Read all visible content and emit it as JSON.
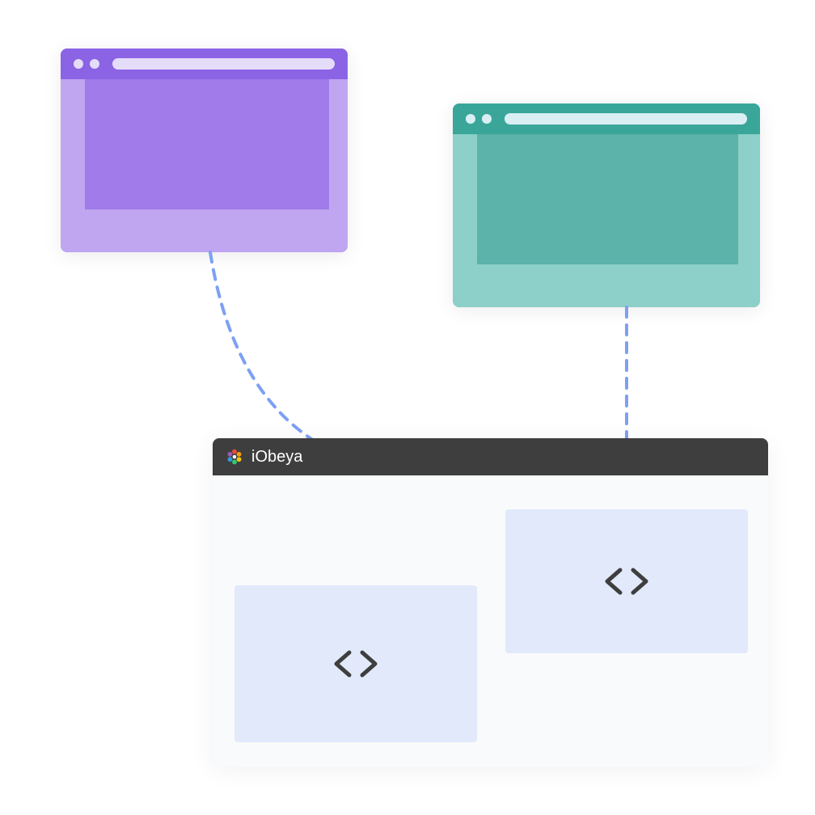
{
  "iobeya": {
    "title": "iObeya"
  },
  "windows": {
    "purple": {
      "color": "#8b63e5"
    },
    "teal": {
      "color": "#3aa69a"
    }
  },
  "icons": {
    "code": "code-icon",
    "logo": "iobeya-logo-icon"
  }
}
